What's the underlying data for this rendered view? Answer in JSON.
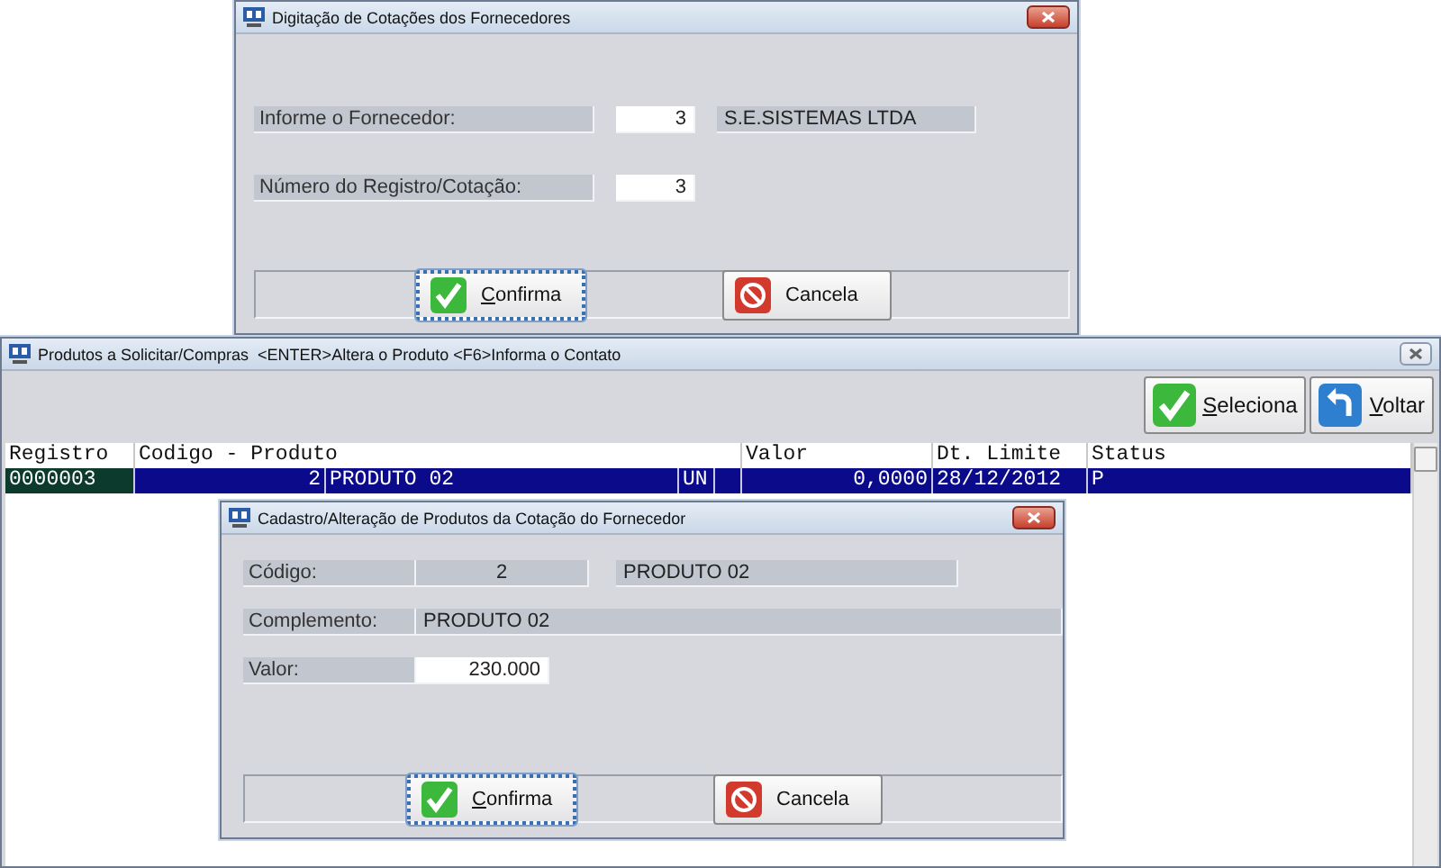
{
  "supplier_dialog": {
    "title": "Digitação de Cotações dos Fornecedores",
    "fields": [
      {
        "label": "Informe o Fornecedor:",
        "kind": "input",
        "value": "3",
        "description": "S.E.SISTEMAS LTDA"
      },
      {
        "label": "Número do Registro/Cotação:",
        "kind": "input",
        "value": "3"
      }
    ],
    "buttons": [
      {
        "kind": "confirm",
        "label": "Confirma",
        "focused": true
      },
      {
        "kind": "cancel",
        "label": "Cancela",
        "focused": false
      }
    ]
  },
  "products_window": {
    "title": "Produtos a Solicitar/Compras  <ENTER>Altera o Produto <F6>Informa o Contato",
    "buttons": [
      {
        "kind": "confirm",
        "label": "Seleciona",
        "focused": false
      },
      {
        "kind": "back",
        "label": "Voltar",
        "focused": false
      }
    ],
    "table": {
      "columns": [
        "Registro",
        "Codigo - Produto",
        "Valor",
        "Dt. Limite",
        "Status"
      ],
      "rows": [
        {
          "selected": true,
          "registro": "0000003",
          "codigo": "2",
          "produto": "PRODUTO 02",
          "unidade": "UN",
          "valor": "0,0000",
          "dt_limite": "28/12/2012",
          "status": "P"
        }
      ]
    }
  },
  "product_dialog": {
    "title": "Cadastro/Alteração de Produtos da Cotação do Fornecedor",
    "fields": [
      {
        "label": "Código:",
        "kind": "display",
        "value": "2",
        "description": "PRODUTO 02"
      },
      {
        "label": "Complemento:",
        "kind": "wide",
        "value": "PRODUTO 02"
      },
      {
        "label": "Valor:",
        "kind": "input",
        "value": "230.000"
      }
    ],
    "buttons": [
      {
        "kind": "confirm",
        "label": "Confirma",
        "focused": true
      },
      {
        "kind": "cancel",
        "label": "Cancela",
        "focused": false
      }
    ]
  }
}
